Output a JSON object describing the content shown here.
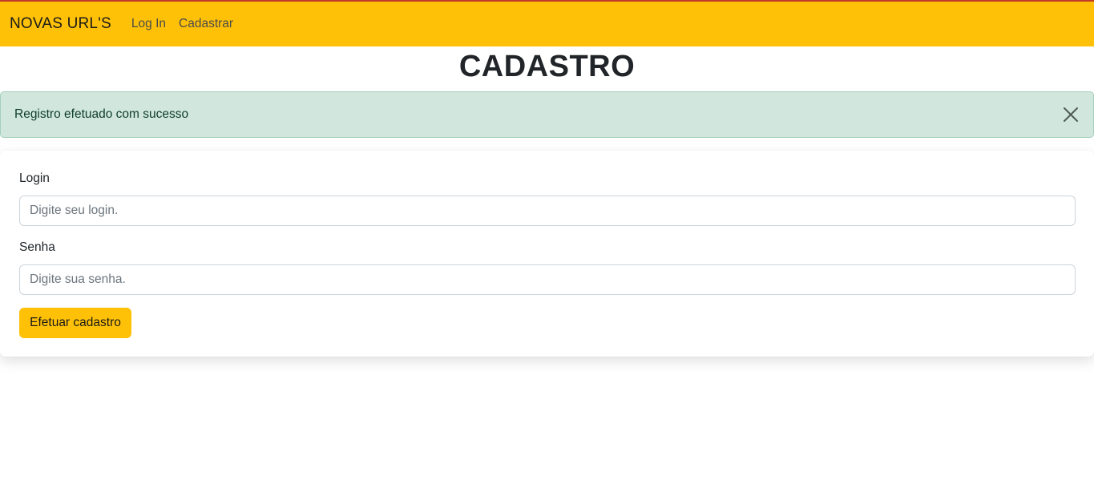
{
  "navbar": {
    "brand": "NOVAS URL'S",
    "links": [
      "Log In",
      "Cadastrar"
    ]
  },
  "page": {
    "title": "CADASTRO"
  },
  "alert": {
    "message": "Registro efetuado com sucesso",
    "close_icon": "close-icon"
  },
  "form": {
    "login_label": "Login",
    "login_placeholder": "Digite seu login.",
    "login_value": "",
    "password_label": "Senha",
    "password_placeholder": "Digite sua senha.",
    "password_value": "",
    "submit_label": "Efetuar cadastro"
  },
  "colors": {
    "accent": "#ffc107",
    "alert_bg": "#d1e7dd",
    "alert_text": "#0f3d2a"
  }
}
